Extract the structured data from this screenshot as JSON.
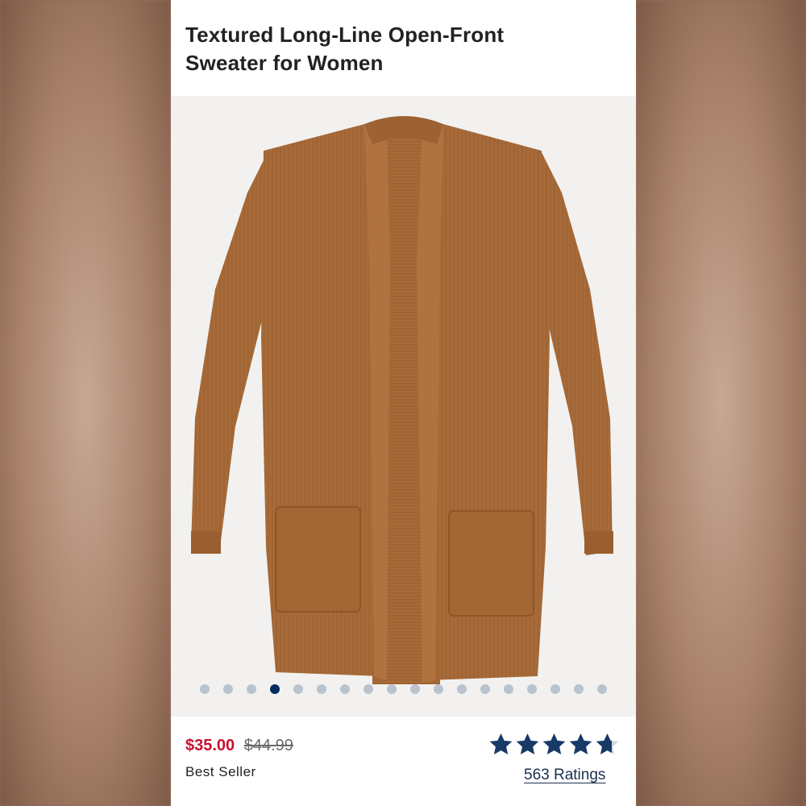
{
  "product": {
    "title_line1": "Textured Long-Line Open-Front",
    "title_line2": "Sweater for Women",
    "image_alt": "Brown ribbed long-line open-front cardigan sweater",
    "sweater_color": "#a76a38",
    "price": {
      "sale": "$35.00",
      "original": "$44.99",
      "sale_color": "#c8102e"
    },
    "badge": "Best Seller",
    "rating": {
      "stars": 4.7,
      "max": 5,
      "count_label": "563 Ratings",
      "star_color": "#173a66"
    },
    "carousel": {
      "total": 18,
      "active_index": 3
    }
  }
}
